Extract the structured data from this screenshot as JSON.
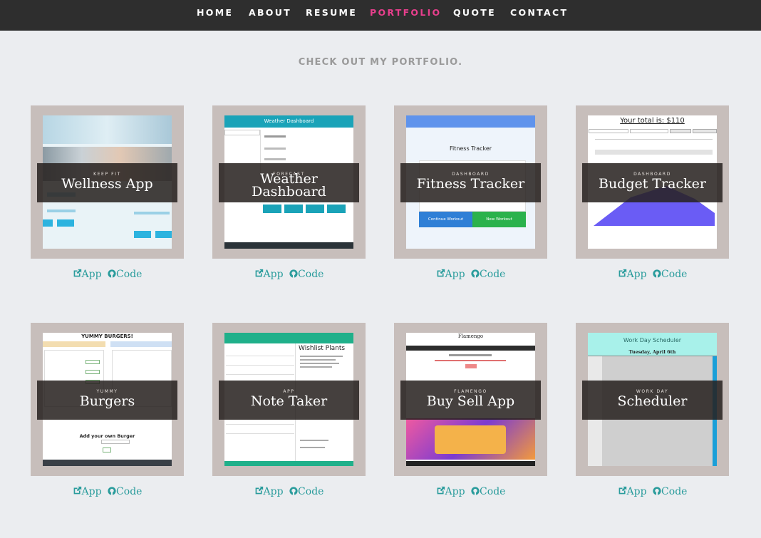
{
  "nav": {
    "items": [
      {
        "label": "HOME"
      },
      {
        "label": "ABOUT"
      },
      {
        "label": "RESUME"
      },
      {
        "label": "PORTFOLIO"
      },
      {
        "label": "QUOTE"
      },
      {
        "label": "CONTACT"
      }
    ],
    "active": "PORTFOLIO"
  },
  "section_title": "CHECK OUT MY PORTFOLIO.",
  "projects": [
    {
      "kicker": "KEEP FIT",
      "name": "Wellness App",
      "app_label": "App",
      "code_label": "Code"
    },
    {
      "kicker": "FORECAST",
      "name": "Weather Dashboard",
      "app_label": "App",
      "code_label": "Code"
    },
    {
      "kicker": "DASHBOARD",
      "name": "Fitness Tracker",
      "app_label": "App",
      "code_label": "Code"
    },
    {
      "kicker": "DASHBOARD",
      "name": "Budget Tracker",
      "app_label": "App",
      "code_label": "Code"
    },
    {
      "kicker": "YUMMY",
      "name": "Burgers",
      "app_label": "App",
      "code_label": "Code"
    },
    {
      "kicker": "APP",
      "name": "Note Taker",
      "app_label": "App",
      "code_label": "Code"
    },
    {
      "kicker": "FLAMENGO",
      "name": "Buy Sell App",
      "app_label": "App",
      "code_label": "Code"
    },
    {
      "kicker": "WORK DAY",
      "name": "Scheduler",
      "app_label": "App",
      "code_label": "Code"
    }
  ],
  "screens": {
    "weather_header": "Weather Dashboard",
    "fitness_header": "Fitness Tracker",
    "fitness_btn1": "Continue Workout",
    "fitness_btn2": "New Workout",
    "budget_total": "Your total is: $110",
    "burgers_title": "YUMMY BURGERS!",
    "burgers_add": "Add your own Burger",
    "wishlist_title": "Wishlist Plants",
    "flamengo_title": "Flamengo",
    "scheduler_title": "Work Day Scheduler",
    "scheduler_date": "Tuesday, April 6th"
  },
  "colors": {
    "nav_bg": "#2e2e2e",
    "accent": "#e83f8d",
    "link": "#2a9c9c",
    "card_bg": "#c7bebb"
  }
}
